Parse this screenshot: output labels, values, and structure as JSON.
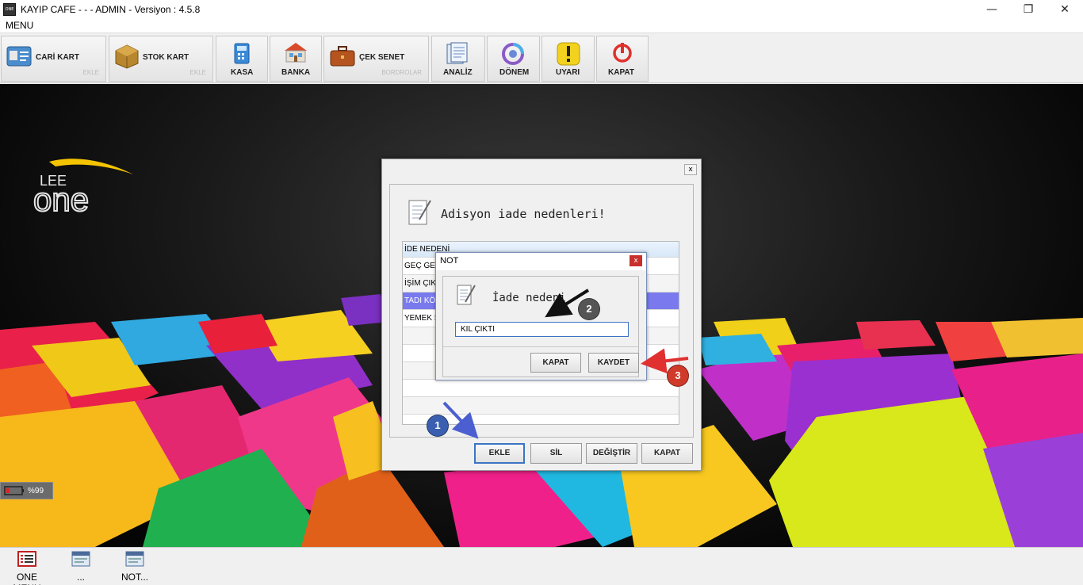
{
  "window": {
    "title": "KAYIP CAFE -  -  - ADMIN -  Versiyon : 4.5.8",
    "app_icon_text": "ONE"
  },
  "menu": {
    "label": "MENU"
  },
  "toolbar": {
    "cari_kart": {
      "label": "CARİ KART",
      "sub": "EKLE"
    },
    "stok_kart": {
      "label": "STOK KART",
      "sub": "EKLE"
    },
    "kasa": {
      "label": "KASA"
    },
    "banka": {
      "label": "BANKA"
    },
    "cek_senet": {
      "label": "ÇEK SENET",
      "sub": "BORDROLAR"
    },
    "analiz": {
      "label": "ANALİZ"
    },
    "donem": {
      "label": "DÖNEM"
    },
    "uyari": {
      "label": "UYARI"
    },
    "kapat": {
      "label": "KAPAT"
    }
  },
  "logo": {
    "top": "LEE",
    "bottom": "one"
  },
  "battery": {
    "text": "%99"
  },
  "main_dialog": {
    "title": "Adisyon iade nedenleri!",
    "close": "x",
    "rows": [
      "İDE NEDENİ",
      "GEÇ GEL",
      "İŞİM ÇIK",
      "TADI KÖ",
      "YEMEK S",
      "",
      "",
      "",
      "",
      ""
    ],
    "buttons": {
      "ekle": "EKLE",
      "sil": "SİL",
      "degistir": "DEĞİŞTİR",
      "kapat": "KAPAT"
    }
  },
  "not_dialog": {
    "title": "NOT",
    "close": "x",
    "label": "İade nedeni",
    "input_value": "KIL ÇIKTI",
    "buttons": {
      "kapat": "KAPAT",
      "kaydet": "KAYDET"
    }
  },
  "markers": {
    "one": "1",
    "two": "2",
    "three": "3"
  },
  "taskbar": {
    "items": [
      {
        "label": "ONE MENU"
      },
      {
        "label": "..."
      },
      {
        "label": "NOT..."
      }
    ]
  },
  "colors": {
    "selection": "#7a7aee",
    "marker_blue": "#3a5fb0",
    "marker_gray": "#555555",
    "marker_red": "#d03a2a",
    "arrow_blue": "#4b5fd0",
    "arrow_red": "#e03030"
  }
}
